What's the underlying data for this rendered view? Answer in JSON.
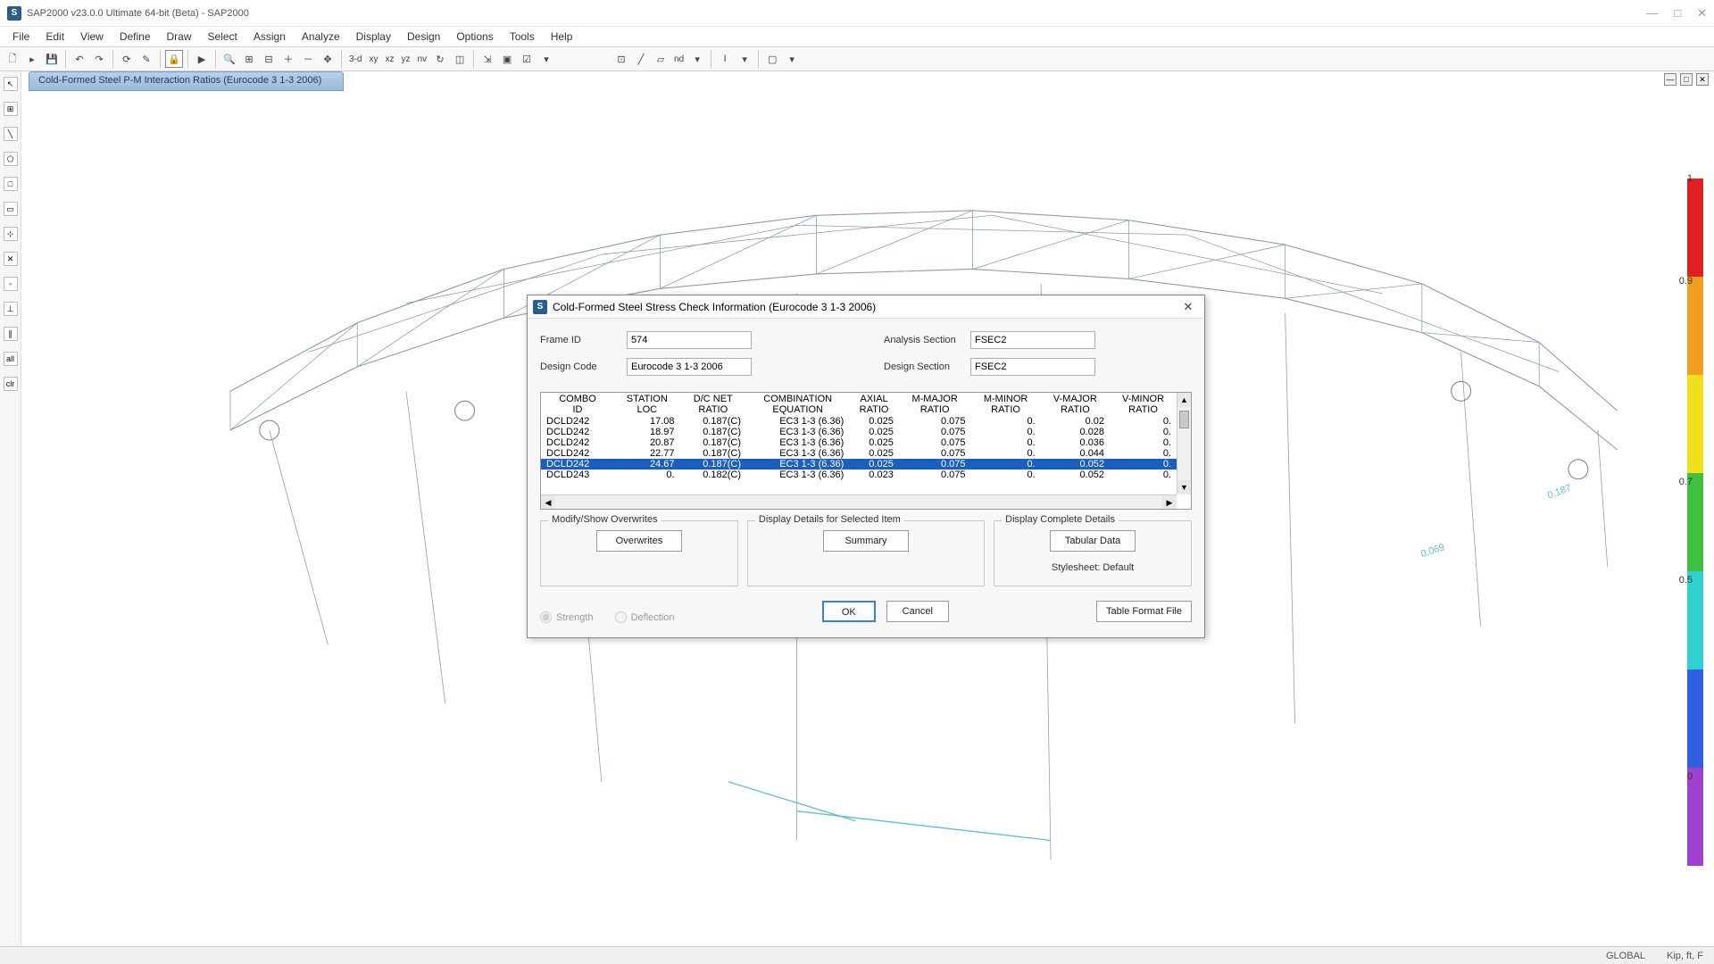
{
  "app": {
    "title": "SAP2000 v23.0.0 Ultimate 64-bit (Beta) - SAP2000",
    "icon_letter": "S"
  },
  "menu": [
    "File",
    "Edit",
    "View",
    "Define",
    "Draw",
    "Select",
    "Assign",
    "Analyze",
    "Display",
    "Design",
    "Options",
    "Tools",
    "Help"
  ],
  "toolbar_text": {
    "threeD": "3-d",
    "xy": "xy",
    "xz": "xz",
    "yz": "yz",
    "nv": "nv",
    "nd": "nd"
  },
  "view_tab": "Cold-Formed Steel P-M Interaction Ratios  (Eurocode 3 1-3 2006)",
  "legend": {
    "colors": [
      "#e02020",
      "#f0a020",
      "#f0e020",
      "#40c040",
      "#30d0d0",
      "#3060e0",
      "#a040d0"
    ],
    "labels": [
      "1",
      "0.9",
      "0.7",
      "0.5",
      "0"
    ]
  },
  "canvas_labels": {
    "a": "0.187",
    "b": "0.069"
  },
  "statusbar": {
    "coord": "GLOBAL",
    "units": "Kip, ft, F"
  },
  "dialog": {
    "title": "Cold-Formed Steel Stress Check Information (Eurocode 3 1-3 2006)",
    "frame_id_label": "Frame ID",
    "frame_id": "574",
    "design_code_label": "Design Code",
    "design_code": "Eurocode 3 1-3 2006",
    "analysis_section_label": "Analysis Section",
    "analysis_section": "FSEC2",
    "design_section_label": "Design Section",
    "design_section": "FSEC2",
    "headers": [
      "COMBO\nID",
      "STATION\nLOC",
      "D/C NET\nRATIO",
      "COMBINATION\nEQUATION",
      "AXIAL\nRATIO",
      "M-MAJOR\nRATIO",
      "M-MINOR\nRATIO",
      "V-MAJOR\nRATIO",
      "V-MINOR\nRATIO"
    ],
    "rows": [
      {
        "c": [
          "DCLD242",
          "17.08",
          "0.187(C)",
          "EC3 1-3 (6.36)",
          "0.025",
          "0.075",
          "0.",
          "0.02",
          "0."
        ],
        "sel": false
      },
      {
        "c": [
          "DCLD242",
          "18.97",
          "0.187(C)",
          "EC3 1-3 (6.36)",
          "0.025",
          "0.075",
          "0.",
          "0.028",
          "0."
        ],
        "sel": false
      },
      {
        "c": [
          "DCLD242",
          "20.87",
          "0.187(C)",
          "EC3 1-3 (6.36)",
          "0.025",
          "0.075",
          "0.",
          "0.036",
          "0."
        ],
        "sel": false
      },
      {
        "c": [
          "DCLD242",
          "22.77",
          "0.187(C)",
          "EC3 1-3 (6.36)",
          "0.025",
          "0.075",
          "0.",
          "0.044",
          "0."
        ],
        "sel": false
      },
      {
        "c": [
          "DCLD242",
          "24.67",
          "0.187(C)",
          "EC3 1-3 (6.36)",
          "0.025",
          "0.075",
          "0.",
          "0.052",
          "0."
        ],
        "sel": true
      },
      {
        "c": [
          "DCLD243",
          "0.",
          "0.182(C)",
          "EC3 1-3 (6.36)",
          "0.023",
          "0.075",
          "0.",
          "0.052",
          "0."
        ],
        "sel": false
      }
    ],
    "group1_label": "Modify/Show Overwrites",
    "group1_btn": "Overwrites",
    "group2_label": "Display Details for Selected Item",
    "group2_btn": "Summary",
    "group3_label": "Display Complete Details",
    "group3_btn": "Tabular Data",
    "radio_strength": "Strength",
    "radio_deflection": "Deflection",
    "stylesheet": "Stylesheet: Default",
    "ok": "OK",
    "cancel": "Cancel",
    "table_format": "Table Format File"
  }
}
